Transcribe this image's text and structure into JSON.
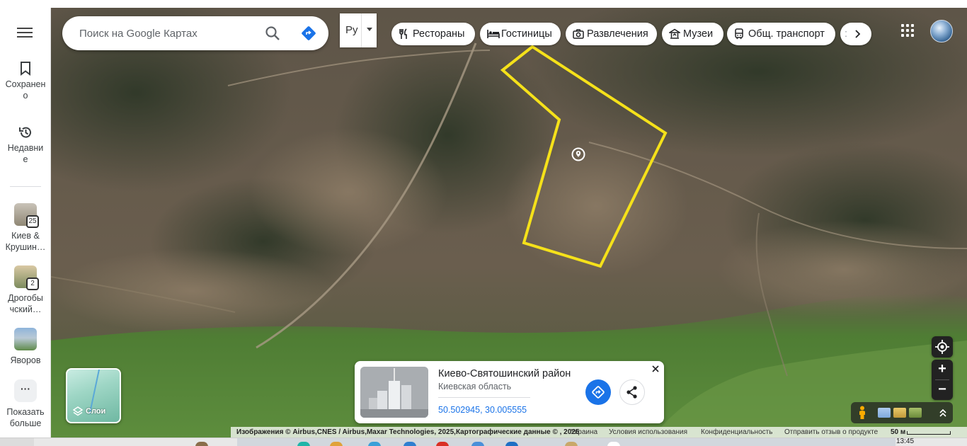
{
  "rail": {
    "saved_label": "Сохранено",
    "recent_label": "Недавние",
    "recent_places": [
      {
        "label": "Киев & Крушин…",
        "badge": "25"
      },
      {
        "label": "Дрогобычский…",
        "badge": "2"
      },
      {
        "label": "Яворов"
      }
    ],
    "more_label": "Показать больше"
  },
  "search": {
    "placeholder": "Поиск на Google Картах"
  },
  "lang": {
    "value": "Ру"
  },
  "chips": [
    {
      "label": "Рестораны",
      "icon": "restaurant-icon"
    },
    {
      "label": "Гостиницы",
      "icon": "hotel-icon"
    },
    {
      "label": "Развлечения",
      "icon": "camera-icon"
    },
    {
      "label": "Музеи",
      "icon": "museum-icon"
    },
    {
      "label": "Общ. транспорт",
      "icon": "transit-icon"
    }
  ],
  "layers": {
    "label": "Слои"
  },
  "card": {
    "title": "Киево-Святошинский район",
    "subtitle": "Киевская область",
    "coords": "50.502945, 30.005555"
  },
  "footer": {
    "attribution": "Изображения © Airbus,CNES / Airbus,Maxar Technologies, 2025,Картографические данные © , 2025",
    "country": "Украина",
    "terms": "Условия использования",
    "privacy": "Конфиденциальность",
    "feedback": "Отправить отзыв о продукте",
    "scale": "50 м"
  },
  "taskbar": {
    "clock": "13:45"
  },
  "colors": {
    "outline": "#f5e11a",
    "accent": "#1a73e8"
  }
}
